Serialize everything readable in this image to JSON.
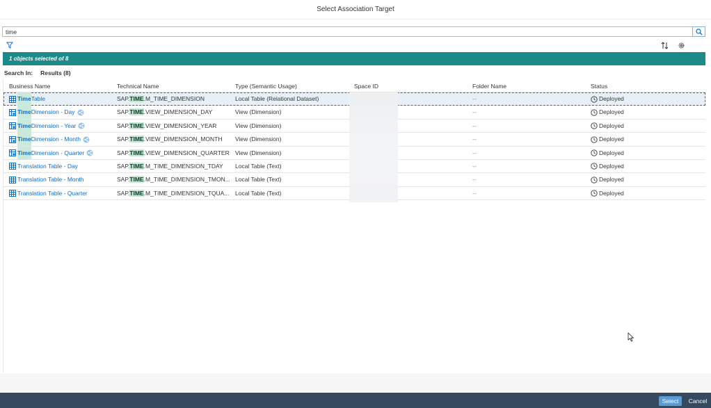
{
  "dialog": {
    "title": "Select Association Target"
  },
  "search": {
    "value": "time"
  },
  "selection": {
    "text": "1 objects selected of 8"
  },
  "search_in": {
    "label": "Search In:",
    "results": "Results (8)"
  },
  "columns": {
    "business_name": "Business Name",
    "technical_name": "Technical Name",
    "type": "Type (Semantic Usage)",
    "space_id": "Space ID",
    "folder_name": "Folder Name",
    "status": "Status"
  },
  "rows": [
    {
      "name_hl": "Time",
      "name_rest": " Table",
      "tech_pre": "SAP.",
      "tech_hl": "TIME",
      "tech_rest": ".M_TIME_DIMENSION",
      "type": "Local Table (Relational Dataset)",
      "folder": "--",
      "status": "Deployed"
    },
    {
      "name_hl": "Time",
      "name_rest": " Dimension - Day",
      "tech_pre": "SAP.",
      "tech_hl": "TIME",
      "tech_rest": ".VIEW_DIMENSION_DAY",
      "type": "View (Dimension)",
      "folder": "--",
      "status": "Deployed"
    },
    {
      "name_hl": "Time",
      "name_rest": " Dimension - Year",
      "tech_pre": "SAP.",
      "tech_hl": "TIME",
      "tech_rest": ".VIEW_DIMENSION_YEAR",
      "type": "View (Dimension)",
      "folder": "--",
      "status": "Deployed"
    },
    {
      "name_hl": "Time",
      "name_rest": " Dimension - Month",
      "tech_pre": "SAP.",
      "tech_hl": "TIME",
      "tech_rest": ".VIEW_DIMENSION_MONTH",
      "type": "View (Dimension)",
      "folder": "--",
      "status": "Deployed"
    },
    {
      "name_hl": "Time",
      "name_rest": " Dimension - Quarter",
      "tech_pre": "SAP.",
      "tech_hl": "TIME",
      "tech_rest": ".VIEW_DIMENSION_QUARTER",
      "type": "View (Dimension)",
      "folder": "--",
      "status": "Deployed"
    },
    {
      "name_hl": "",
      "name_rest": "Translation Table - Day",
      "tech_pre": "SAP.",
      "tech_hl": "TIME",
      "tech_rest": ".M_TIME_DIMENSION_TDAY",
      "type": "Local Table (Text)",
      "folder": "--",
      "status": "Deployed"
    },
    {
      "name_hl": "",
      "name_rest": "Translation Table - Month",
      "tech_pre": "SAP.",
      "tech_hl": "TIME",
      "tech_rest": ".M_TIME_DIMENSION_TMON...",
      "type": "Local Table (Text)",
      "folder": "--",
      "status": "Deployed"
    },
    {
      "name_hl": "",
      "name_rest": "Translation Table - Quarter",
      "tech_pre": "SAP.",
      "tech_hl": "TIME",
      "tech_rest": ".M_TIME_DIMENSION_TQUA...",
      "type": "Local Table (Text)",
      "folder": "--",
      "status": "Deployed"
    }
  ],
  "footer": {
    "select_label": "Select",
    "cancel_label": "Cancel"
  },
  "icons": {
    "search": "search-icon",
    "filter": "filter-icon",
    "sort": "sort-icon",
    "settings": "gear-icon",
    "table": "table-icon",
    "view": "view-icon",
    "shared": "share-icon",
    "status": "clock-icon"
  },
  "colors": {
    "accent": "#1b8a88",
    "link": "#0a6ed1",
    "footer": "#354a5f",
    "highlight": "#c9e6d3"
  }
}
